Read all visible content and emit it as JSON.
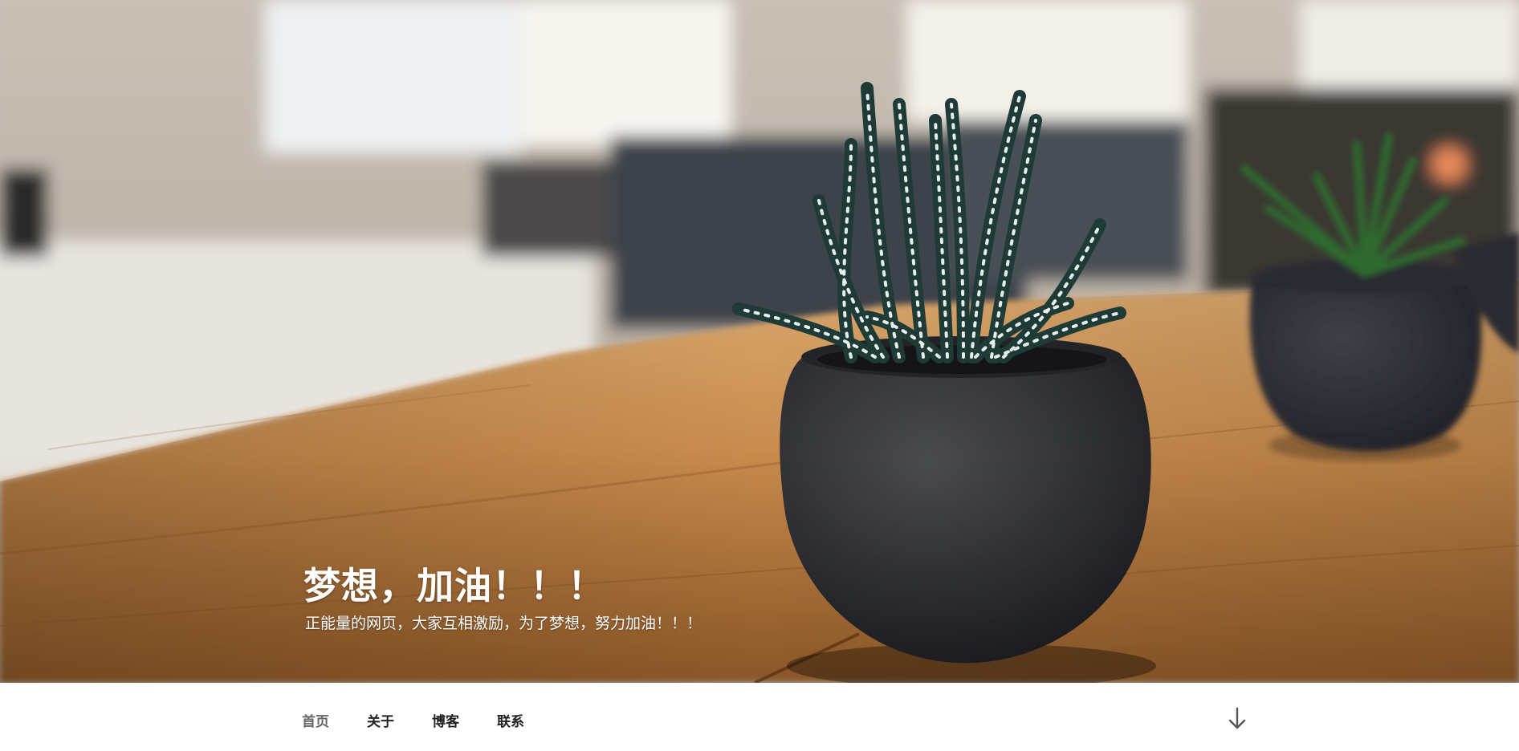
{
  "hero": {
    "title": "梦想，加油！！！",
    "subtitle": "正能量的网页，大家互相激励，为了梦想，努力加油！！！"
  },
  "nav": {
    "items": [
      {
        "label": "首页",
        "active": true
      },
      {
        "label": "关于",
        "active": false
      },
      {
        "label": "博客",
        "active": false
      },
      {
        "label": "联系",
        "active": false
      }
    ],
    "scroll_icon": "arrow-down-icon"
  },
  "colors": {
    "nav_text": "#222222",
    "nav_active_text": "#666666",
    "hero_text": "#ffffff",
    "pot": "#2e2f33",
    "table_wood": "#b77a3e"
  }
}
